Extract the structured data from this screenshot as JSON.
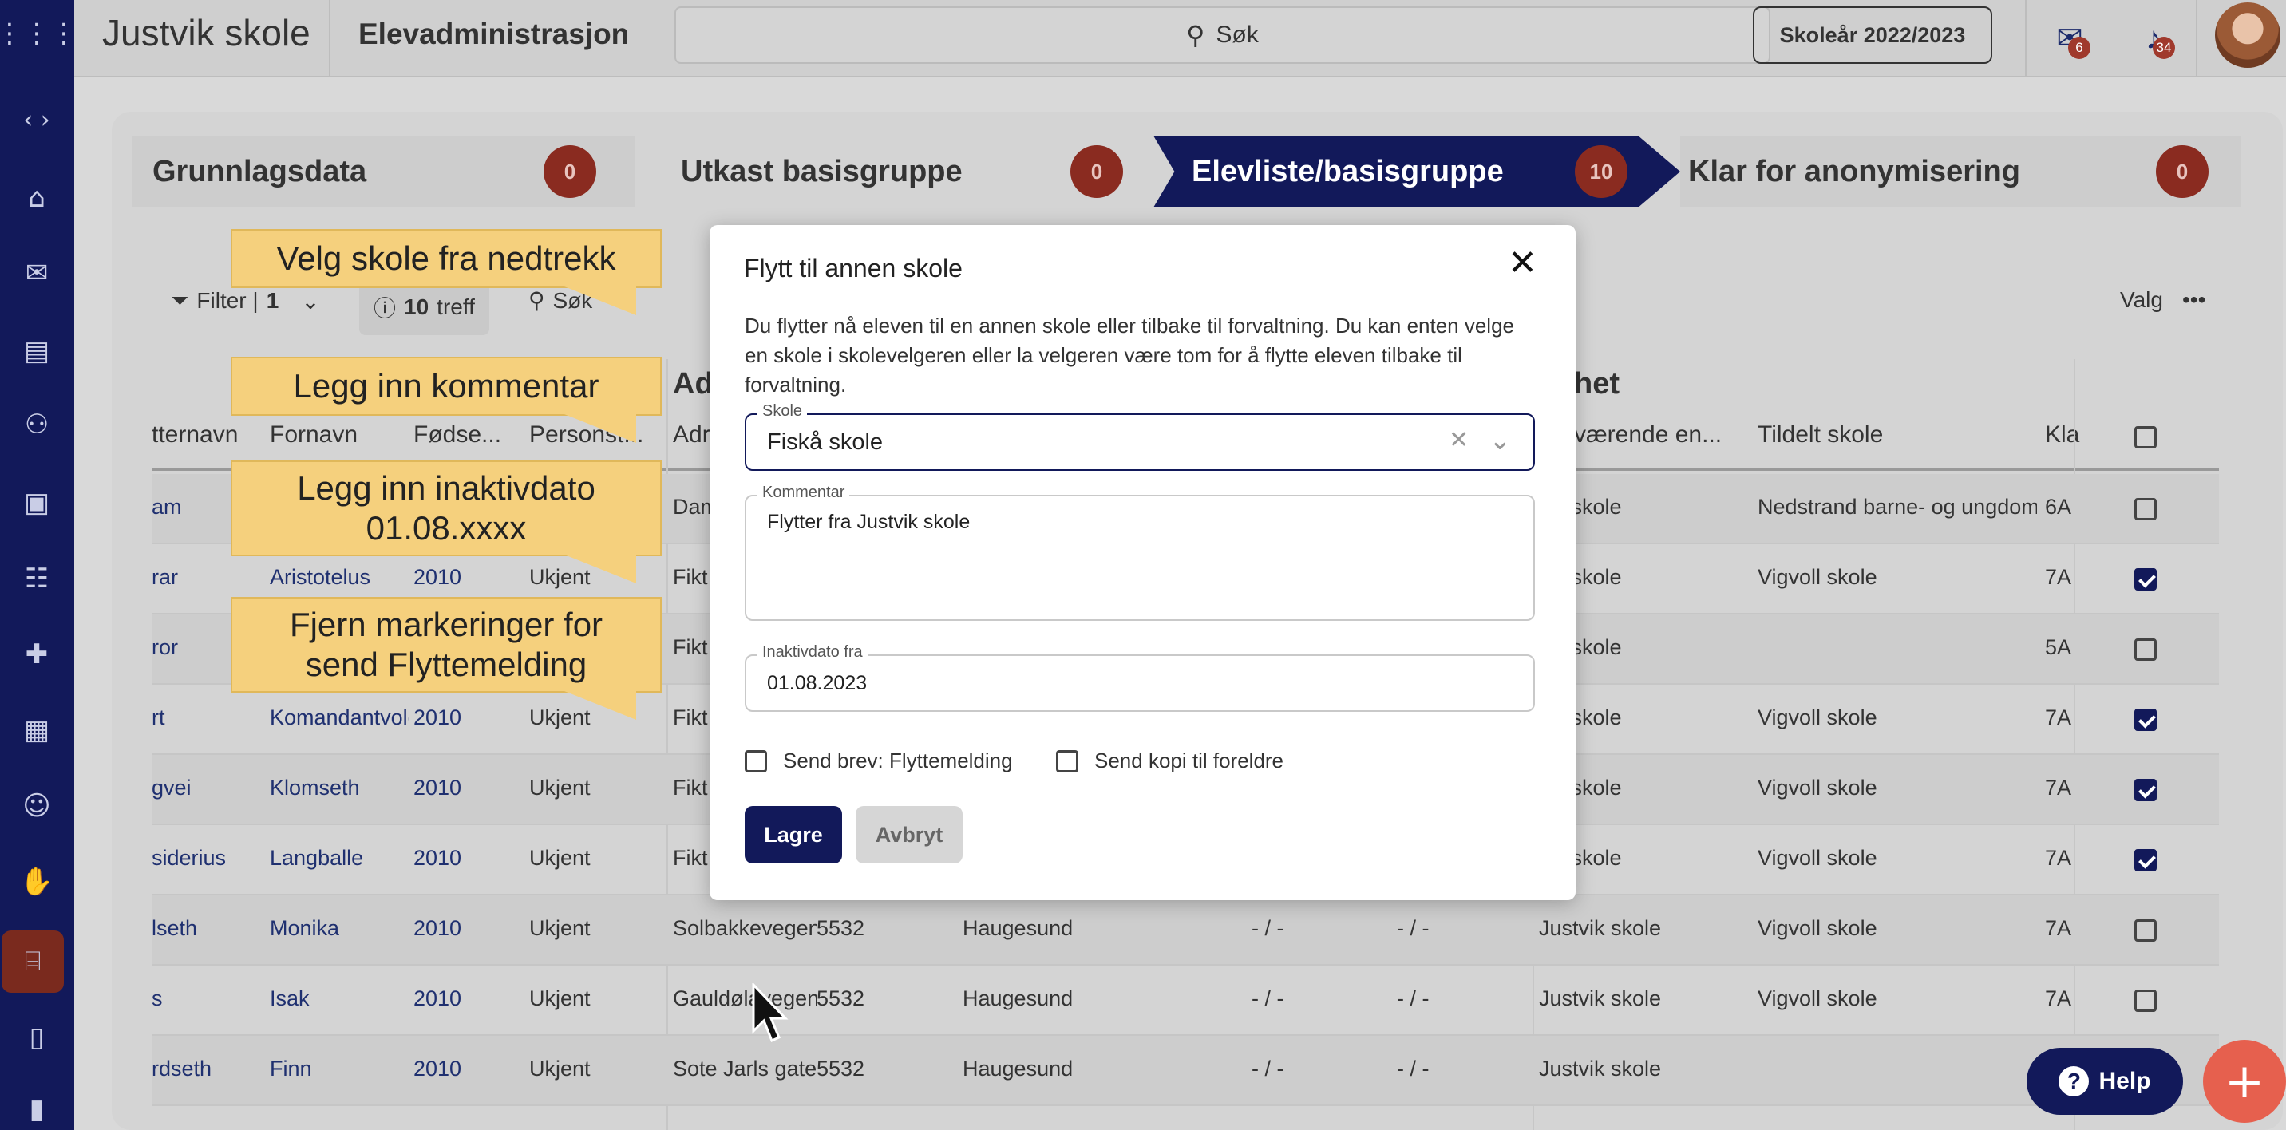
{
  "header": {
    "brand": "Justvik skole",
    "app_title": "Elevadministrasjon",
    "search_label": "Søk",
    "school_year": "Skoleår 2022/2023",
    "mail_count": "6",
    "notif_count": "34"
  },
  "steps": [
    {
      "label": "Grunnlagsdata",
      "count": "0"
    },
    {
      "label": "Utkast basisgruppe",
      "count": "0"
    },
    {
      "label": "Elevliste/basisgruppe",
      "count": "10"
    },
    {
      "label": "Klar for anonymisering",
      "count": "0"
    }
  ],
  "toolbar": {
    "filter_label": "Filter |",
    "filter_count": "1",
    "hits_count": "10",
    "hits_label": "treff",
    "search_label": "Søk",
    "options_label": "Valg"
  },
  "table": {
    "group_headers": [
      "Ad",
      "het"
    ],
    "columns": [
      "tternavn",
      "Fornavn",
      "Fødse...",
      "Personst...",
      "Adr",
      "værende en...",
      "Tildelt skole",
      "Kla"
    ],
    "rows": [
      {
        "etternavn": "am",
        "fornavn": "",
        "fodsel": "",
        "status": "",
        "adresse": "Dam",
        "post": "",
        "sted": "",
        "a": "",
        "b": "",
        "skole": "vik skole",
        "tildelt": "Nedstrand barne- og ungdoms",
        "klasse": "6A",
        "checked": false
      },
      {
        "etternavn": "rar",
        "fornavn": "Aristotelus",
        "fodsel": "2010",
        "status": "Ukjent",
        "adresse": "Fikt",
        "post": "",
        "sted": "",
        "a": "",
        "b": "",
        "skole": "vik skole",
        "tildelt": "Vigvoll skole",
        "klasse": "7A",
        "checked": true
      },
      {
        "etternavn": "ror",
        "fornavn": "",
        "fodsel": "",
        "status": "",
        "adresse": "Fikt",
        "post": "",
        "sted": "",
        "a": "",
        "b": "",
        "skole": "vik skole",
        "tildelt": "",
        "klasse": "5A",
        "checked": false
      },
      {
        "etternavn": "rt",
        "fornavn": "Komandantvolc",
        "fodsel": "2010",
        "status": "Ukjent",
        "adresse": "Fikt",
        "post": "",
        "sted": "",
        "a": "",
        "b": "",
        "skole": "vik skole",
        "tildelt": "Vigvoll skole",
        "klasse": "7A",
        "checked": true
      },
      {
        "etternavn": "gvei",
        "fornavn": "Klomseth",
        "fodsel": "2010",
        "status": "Ukjent",
        "adresse": "Fikt",
        "post": "",
        "sted": "",
        "a": "",
        "b": "",
        "skole": "vik skole",
        "tildelt": "Vigvoll skole",
        "klasse": "7A",
        "checked": true
      },
      {
        "etternavn": "siderius",
        "fornavn": "Langballe",
        "fodsel": "2010",
        "status": "Ukjent",
        "adresse": "Fikt",
        "post": "",
        "sted": "",
        "a": "",
        "b": "",
        "skole": "vik skole",
        "tildelt": "Vigvoll skole",
        "klasse": "7A",
        "checked": true
      },
      {
        "etternavn": "lseth",
        "fornavn": "Monika",
        "fodsel": "2010",
        "status": "Ukjent",
        "adresse": "Solbakkevegen",
        "post": "5532",
        "sted": "Haugesund",
        "a": "- / -",
        "b": "- / -",
        "skole": "Justvik skole",
        "tildelt": "Vigvoll skole",
        "klasse": "7A",
        "checked": false
      },
      {
        "etternavn": "s",
        "fornavn": "Isak",
        "fodsel": "2010",
        "status": "Ukjent",
        "adresse": "Gauldølavegen",
        "post": "5532",
        "sted": "Haugesund",
        "a": "- / -",
        "b": "- / -",
        "skole": "Justvik skole",
        "tildelt": "Vigvoll skole",
        "klasse": "7A",
        "checked": false
      },
      {
        "etternavn": "rdseth",
        "fornavn": "Finn",
        "fodsel": "2010",
        "status": "Ukjent",
        "adresse": "Sote Jarls gate !",
        "post": "5532",
        "sted": "Haugesund",
        "a": "- / -",
        "b": "- / -",
        "skole": "Justvik skole",
        "tildelt": "",
        "klasse": "",
        "checked": false
      }
    ]
  },
  "callouts": [
    "Velg skole fra nedtrekk",
    "Legg inn kommentar",
    "Legg inn inaktivdato 01.08.xxxx",
    "Fjern markeringer for send Flyttemelding"
  ],
  "modal": {
    "title": "Flytt til annen skole",
    "description": "Du flytter nå eleven til en annen skole eller tilbake til forvaltning. Du kan enten velge en skole i skolevelgeren eller la velgeren være tom for å flytte eleven tilbake til forvaltning.",
    "school_label": "Skole",
    "school_value": "Fiskå skole",
    "comment_label": "Kommentar",
    "comment_value": "Flytter fra Justvik skole",
    "date_label": "Inaktivdato fra",
    "date_value": "01.08.2023",
    "send_letter_label": "Send brev: Flyttemelding",
    "send_copy_label": "Send kopi til foreldre",
    "save_label": "Lagre",
    "cancel_label": "Avbryt"
  },
  "help_label": "Help",
  "colors": {
    "navy": "#12195a",
    "badge": "#8a2b20",
    "callout": "#f5d07d",
    "fab": "#e6604e"
  }
}
